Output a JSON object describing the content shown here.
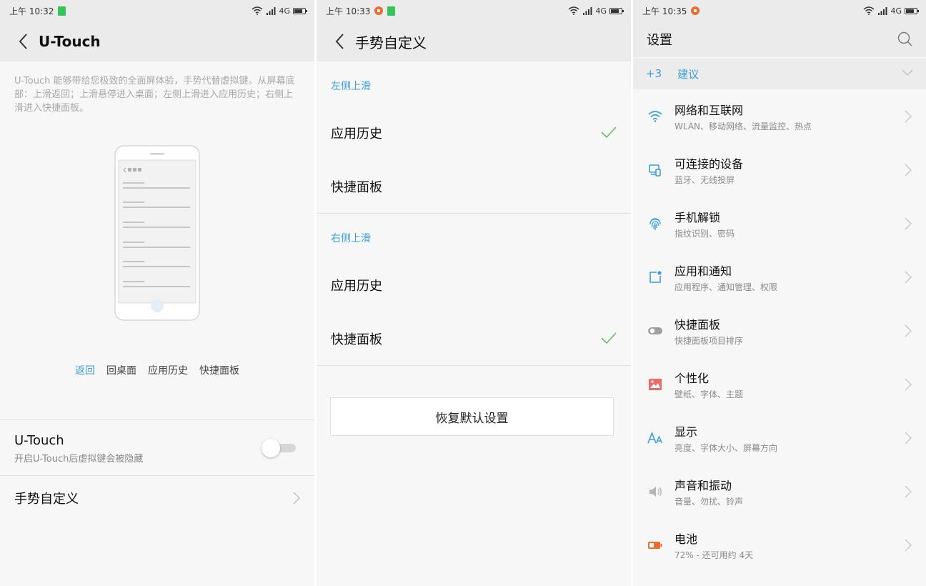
{
  "screen1": {
    "status": {
      "time": "上午 10:32",
      "network": "4G"
    },
    "title": "U-Touch",
    "description": "U-Touch 能够带给您极致的全面屏体验，手势代替虚拟键。从屏幕底部：上滑返回；上滑悬停进入桌面；左侧上滑进入应用历史；右侧上滑进入快捷面板。",
    "gesture_tabs": [
      "返回",
      "回桌面",
      "应用历史",
      "快捷面板"
    ],
    "active_tab": "返回",
    "utouch": {
      "label": "U-Touch",
      "sublabel": "开启U-Touch后虚拟键会被隐藏",
      "enabled": false
    },
    "custom_gesture": "手势自定义"
  },
  "screen2": {
    "status": {
      "time": "上午 10:33",
      "network": "4G"
    },
    "title": "手势自定义",
    "left_section": {
      "header": "左侧上滑",
      "options": [
        {
          "label": "应用历史",
          "checked": true
        },
        {
          "label": "快捷面板",
          "checked": false
        }
      ]
    },
    "right_section": {
      "header": "右侧上滑",
      "options": [
        {
          "label": "应用历史",
          "checked": false
        },
        {
          "label": "快捷面板",
          "checked": true
        }
      ]
    },
    "restore_button": "恢复默认设置"
  },
  "screen3": {
    "status": {
      "time": "上午 10:35",
      "network": "4G"
    },
    "title": "设置",
    "suggestion": {
      "count": "+3",
      "label": "建议"
    },
    "items": [
      {
        "icon": "wifi-icon",
        "title": "网络和互联网",
        "subtitle": "WLAN、移动网络、流量监控、热点",
        "color": "#3a9ce6"
      },
      {
        "icon": "devices-icon",
        "title": "可连接的设备",
        "subtitle": "蓝牙、无线投屏",
        "color": "#3a9ce6"
      },
      {
        "icon": "fingerprint-icon",
        "title": "手机解锁",
        "subtitle": "指纹识别、密码",
        "color": "#3a9ce6"
      },
      {
        "icon": "apps-notification-icon",
        "title": "应用和通知",
        "subtitle": "应用程序、通知管理、权限",
        "color": "#3a9ce6"
      },
      {
        "icon": "toggle-icon",
        "title": "快捷面板",
        "subtitle": "快捷面板项目排序",
        "color": "#9a9a9a"
      },
      {
        "icon": "wallpaper-icon",
        "title": "个性化",
        "subtitle": "壁纸、字体、主题",
        "color": "#ef6a6a"
      },
      {
        "icon": "font-size-icon",
        "title": "显示",
        "subtitle": "亮度、字体大小、屏幕方向",
        "color": "#3a9ce6"
      },
      {
        "icon": "speaker-icon",
        "title": "声音和振动",
        "subtitle": "音量、勿扰、铃声",
        "color": "#b5b5b5"
      },
      {
        "icon": "battery-icon",
        "title": "电池",
        "subtitle": "72% - 还可用约 4天",
        "color": "#ee6b2f"
      }
    ]
  },
  "colors": {
    "accent": "#3a9ce6",
    "check": "#5cc35c",
    "background": "#f7f7f7",
    "bar": "#ebebeb"
  }
}
